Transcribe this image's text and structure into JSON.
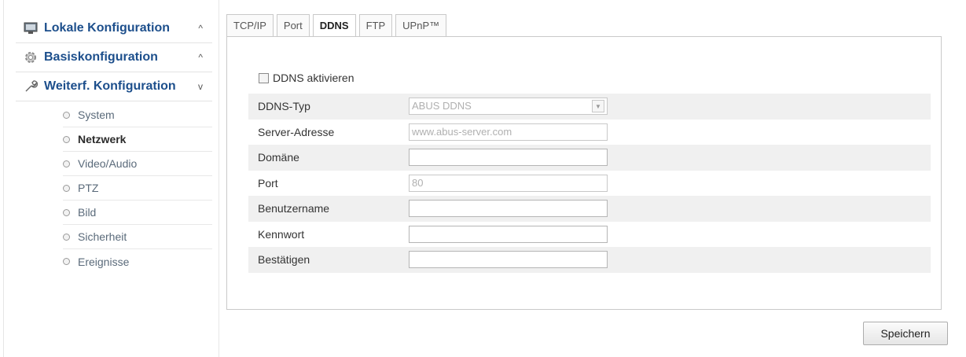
{
  "sidebar": {
    "sections": [
      {
        "label": "Lokale Konfiguration",
        "icon": "monitor-icon",
        "chevron": "^"
      },
      {
        "label": "Basiskonfiguration",
        "icon": "gear-icon",
        "chevron": "^"
      },
      {
        "label": "Weiterf. Konfiguration",
        "icon": "wrench-icon",
        "chevron": "v"
      }
    ],
    "subitems": [
      "System",
      "Netzwerk",
      "Video/Audio",
      "PTZ",
      "Bild",
      "Sicherheit",
      "Ereignisse"
    ],
    "active_subitem": "Netzwerk"
  },
  "tabs": [
    "TCP/IP",
    "Port",
    "DDNS",
    "FTP",
    "UPnP™"
  ],
  "active_tab": "DDNS",
  "form": {
    "enable_label": "DDNS aktivieren",
    "enable_checked": false,
    "fields": [
      {
        "label": "DDNS-Typ",
        "value": "ABUS DDNS",
        "type": "select"
      },
      {
        "label": "Server-Adresse",
        "value": "www.abus-server.com",
        "type": "text"
      },
      {
        "label": "Domäne",
        "value": "",
        "type": "text"
      },
      {
        "label": "Port",
        "value": "80",
        "type": "text"
      },
      {
        "label": "Benutzername",
        "value": "",
        "type": "text"
      },
      {
        "label": "Kennwort",
        "value": "",
        "type": "password"
      },
      {
        "label": "Bestätigen",
        "value": "",
        "type": "password"
      }
    ]
  },
  "save_label": "Speichern",
  "colors": {
    "section_label": "#1d4f8c",
    "row_shade": "#f0f0f0"
  }
}
